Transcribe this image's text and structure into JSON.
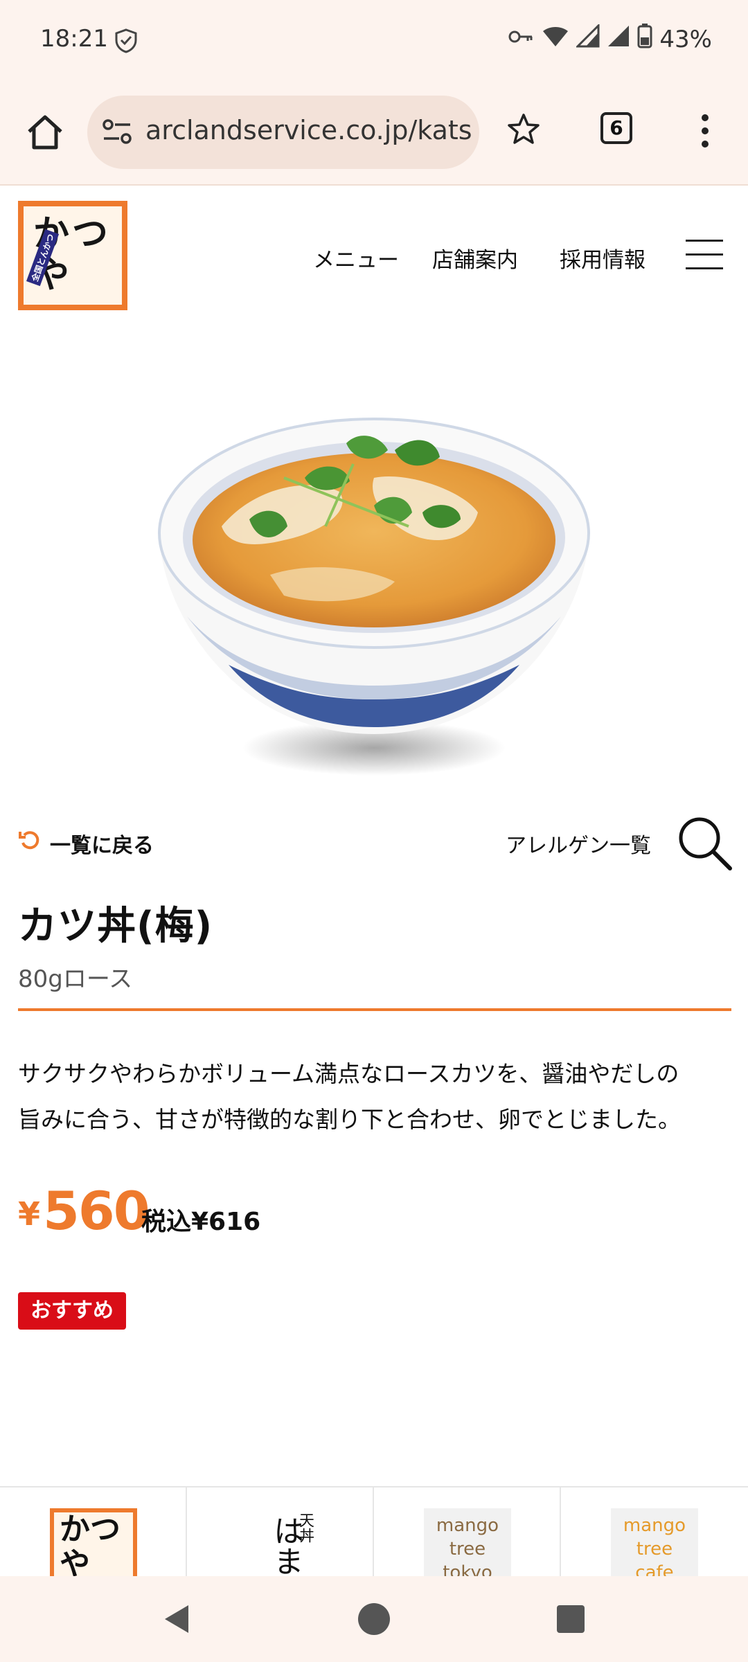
{
  "status_bar": {
    "time": "18:21",
    "battery": "43%"
  },
  "browser": {
    "url": "arclandservice.co.jp/kats",
    "tab_count": "6"
  },
  "site": {
    "logo_text": "かつや",
    "logo_sub": "全国とんかつ",
    "nav": [
      "メニュー",
      "店舗案内",
      "採用情報"
    ]
  },
  "product": {
    "back_label": "一覧に戻る",
    "allergen_label": "アレルゲン一覧",
    "name": "カツ丼(梅)",
    "sub": "80gロース",
    "description_line1": "サクサクやわらかボリューム満点なロースカツを、醤油やだしの",
    "description_line2": "旨みに合う、甘さが特徴的な割り下と合わせ、卵でとじました。",
    "price_symbol": "¥",
    "price": "560",
    "tax_label": "税込¥616",
    "badge": "おすすめ"
  },
  "brands": {
    "tempura_top": "天丼",
    "tempura_name": "はま",
    "mango1": [
      "mango",
      "tree",
      "tokyo"
    ],
    "mango2": [
      "mango",
      "tree",
      "cafe"
    ]
  },
  "colors": {
    "accent": "#ee7a2d",
    "badge": "#d90d17",
    "chrome": "#fdf3ee"
  }
}
